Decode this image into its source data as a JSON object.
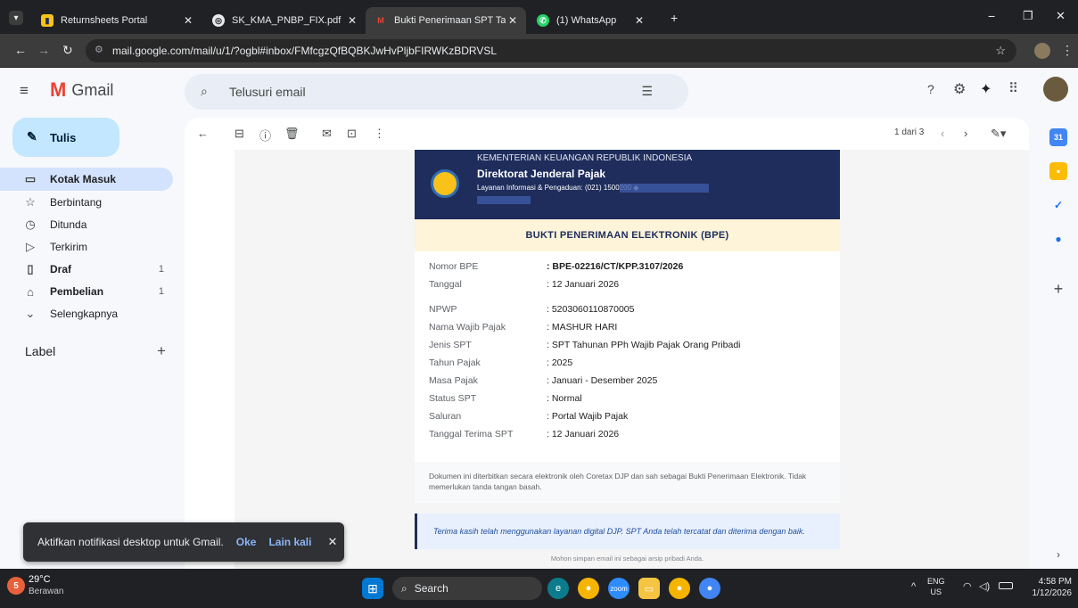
{
  "browser": {
    "tabs": [
      {
        "label": "Returnsheets Portal",
        "icon": "portal-icon"
      },
      {
        "label": "SK_KMA_PNBP_FIX.pdf",
        "icon": "globe-icon"
      },
      {
        "label": "Bukti Penerimaan SPT Tahunan",
        "icon": "gmail-icon"
      },
      {
        "label": "(1) WhatsApp",
        "icon": "whatsapp-icon"
      }
    ],
    "new_tab": "+",
    "url": "mail.google.com/mail/u/1/?ogbl#inbox/FMfcgzQfBQBKJwHvPljbFIRWKzBDRVSL"
  },
  "gmail": {
    "logo_text": "Gmail",
    "search_placeholder": "Telusuri email",
    "compose_label": "Tulis",
    "nav": [
      {
        "label": "Kotak Masuk",
        "icon": "inbox-icon",
        "count": ""
      },
      {
        "label": "Berbintang",
        "icon": "star-icon",
        "count": ""
      },
      {
        "label": "Ditunda",
        "icon": "clock-icon",
        "count": ""
      },
      {
        "label": "Terkirim",
        "icon": "send-icon",
        "count": ""
      },
      {
        "label": "Draf",
        "icon": "draft-icon",
        "count": "1"
      },
      {
        "label": "Pembelian",
        "icon": "bag-icon",
        "count": "1"
      },
      {
        "label": "Selengkapnya",
        "icon": "chevron-down-icon",
        "count": ""
      }
    ],
    "labels_title": "Label",
    "labels_add": "+",
    "pager": "1 dari 3",
    "toast": {
      "message": "Aktifkan notifikasi desktop untuk Gmail.",
      "ok": "Oke",
      "later": "Lain kali",
      "close": "✕"
    }
  },
  "email": {
    "org": "KEMENTERIAN KEUANGAN REPUBLIK INDONESIA",
    "dept": "Direktorat Jenderal Pajak",
    "contact": "Layanan Informasi & Pengaduan: (021) 1500200 ◆",
    "doc_title": "BUKTI PENERIMAAN ELEKTRONIK (BPE)",
    "fields": [
      {
        "key": "Nomor BPE",
        "value": ": BPE-02216/CT/KPP.3107/2026"
      },
      {
        "key": "Tanggal",
        "value": ": 12 Januari 2026"
      },
      {
        "key": "NPWP",
        "value": ": 5203060110870005"
      },
      {
        "key": "Nama Wajib Pajak",
        "value": ": MASHUR HARI"
      },
      {
        "key": "Jenis SPT",
        "value": ": SPT Tahunan PPh Wajib Pajak Orang Pribadi"
      },
      {
        "key": "Tahun Pajak",
        "value": ": 2025"
      },
      {
        "key": "Masa Pajak",
        "value": ": Januari - Desember 2025"
      },
      {
        "key": "Status SPT",
        "value": ": Normal"
      },
      {
        "key": "Saluran",
        "value": ": Portal Wajib Pajak"
      },
      {
        "key": "Tanggal Terima SPT",
        "value": ": 12 Januari 2026"
      }
    ],
    "note": "Dokumen ini diterbitkan secara elektronik oleh Coretax DJP dan sah sebagai Bukti Penerimaan Elektronik. Tidak memerlukan tanda tangan basah.",
    "thanks": "Terima kasih telah menggunakan layanan digital DJP. SPT Anda telah tercatat dan diterima dengan baik.",
    "footer": "Mohon simpan email ini sebagai arsip pribadi Anda."
  },
  "taskbar": {
    "weather_temp": "29°C",
    "weather_desc": "Berawan",
    "weather_badge": "5",
    "search_label": "Search",
    "lang_top": "ENG",
    "lang_bottom": "US",
    "time": "4:58 PM",
    "date": "1/12/2026"
  },
  "colors": {
    "accent": "#1f2d5c",
    "title_band": "#fdf4da",
    "compose": "#c2e7ff",
    "selected_nav": "#d3e3fd"
  }
}
